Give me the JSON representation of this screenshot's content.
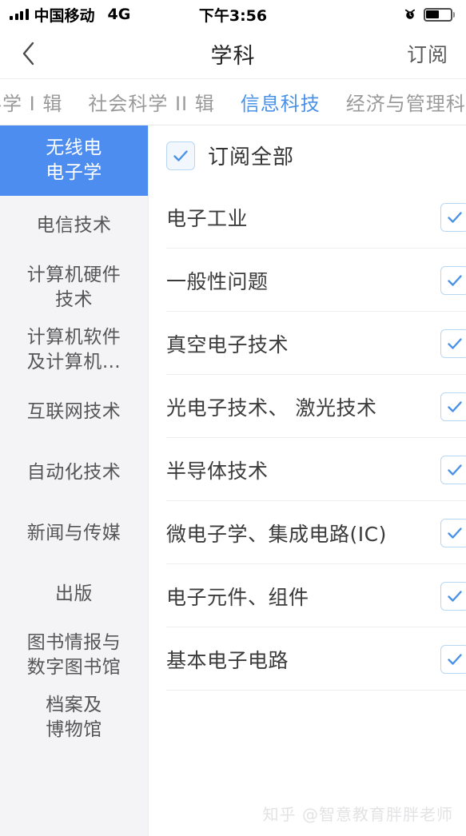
{
  "status_bar": {
    "carrier": "中国移动",
    "network": "4G",
    "time": "下午3:56",
    "signal_bars": 4,
    "battery_percent": 55,
    "alarm_icon": "alarm-clock-icon",
    "battery_icon": "battery-icon"
  },
  "nav_bar": {
    "back_icon": "chevron-left-icon",
    "title": "学科",
    "action_label": "订阅"
  },
  "tabs": {
    "items": [
      {
        "label": "社会科学 I 辑",
        "active": false
      },
      {
        "label": "社会科学 II 辑",
        "active": false
      },
      {
        "label": "信息科技",
        "active": true
      },
      {
        "label": "经济与管理科学",
        "active": false
      }
    ],
    "active_color": "#4a92e8",
    "inactive_color": "#9a9a9a"
  },
  "sidebar": {
    "active_bg": "#4d8df0",
    "bg": "#f4f4f6",
    "items": [
      {
        "label": "无线电\n电子学",
        "active": true
      },
      {
        "label": "电信技术",
        "active": false
      },
      {
        "label": "计算机硬件\n技术",
        "active": false
      },
      {
        "label": "计算机软件\n及计算机…",
        "active": false
      },
      {
        "label": "互联网技术",
        "active": false
      },
      {
        "label": "自动化技术",
        "active": false
      },
      {
        "label": "新闻与传媒",
        "active": false
      },
      {
        "label": "出版",
        "active": false
      },
      {
        "label": "图书情报与\n数字图书馆",
        "active": false
      },
      {
        "label": "档案及\n博物馆",
        "active": false
      }
    ]
  },
  "content": {
    "subscribe_all": {
      "label": "订阅全部",
      "checked": true
    },
    "checkbox_border_color": "#b8d7f4",
    "checkbox_check_color": "#4a92e8",
    "rows": [
      {
        "label": "电子工业",
        "checked": true
      },
      {
        "label": "一般性问题",
        "checked": true
      },
      {
        "label": "真空电子技术",
        "checked": true
      },
      {
        "label": "光电子技术、 激光技术",
        "checked": true
      },
      {
        "label": "半导体技术",
        "checked": true
      },
      {
        "label": "微电子学、集成电路(IC)",
        "checked": true
      },
      {
        "label": "电子元件、组件",
        "checked": true
      },
      {
        "label": "基本电子电路",
        "checked": true
      }
    ]
  },
  "watermark": {
    "text": "知乎 @智意教育胖胖老师"
  }
}
